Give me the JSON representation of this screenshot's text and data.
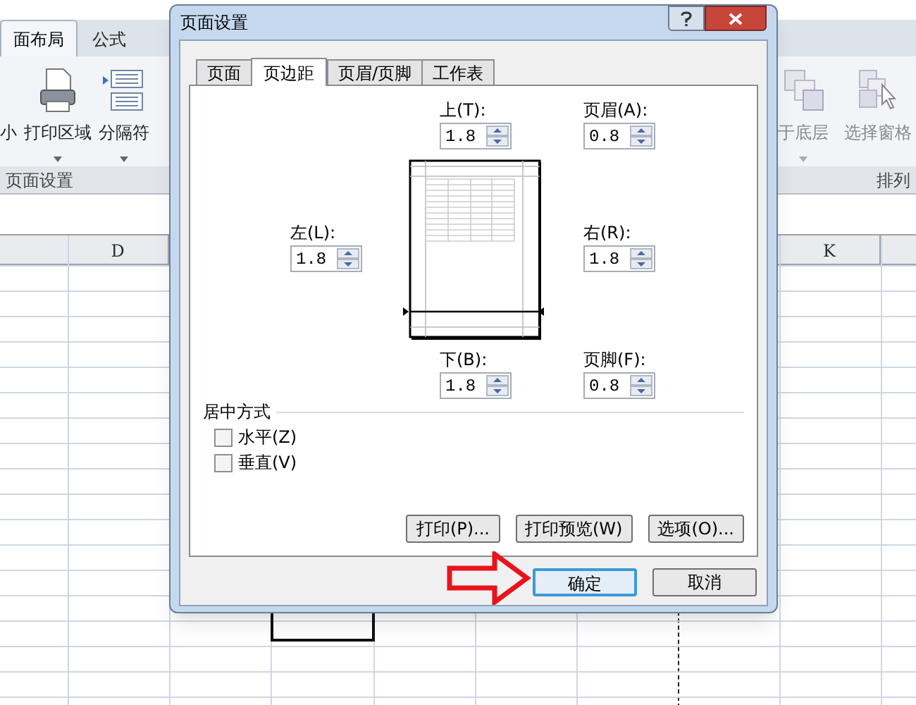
{
  "ribbon": {
    "tabs": [
      {
        "label": "面布局",
        "selected": true
      },
      {
        "label": "公式",
        "selected": false
      }
    ],
    "buttons_left": [
      {
        "label": "小",
        "dropdown": false
      },
      {
        "label": "打印区域",
        "dropdown": true
      },
      {
        "label": "分隔符",
        "dropdown": true
      }
    ],
    "buttons_right": [
      {
        "label": "于底层",
        "dropdown": true
      },
      {
        "label": "选择窗格",
        "dropdown": false
      }
    ],
    "groups": [
      "页面设置",
      "排列"
    ]
  },
  "sheet": {
    "column_headers": [
      "D",
      "K"
    ]
  },
  "dialog": {
    "title": "页面设置",
    "tabs": [
      {
        "label": "页面",
        "selected": false
      },
      {
        "label": "页边距",
        "selected": true
      },
      {
        "label": "页眉/页脚",
        "selected": false
      },
      {
        "label": "工作表",
        "selected": false
      }
    ],
    "margins": [
      {
        "label": "上(T):",
        "value": "1.8"
      },
      {
        "label": "页眉(A):",
        "value": "0.8"
      },
      {
        "label": "左(L):",
        "value": "1.8"
      },
      {
        "label": "右(R):",
        "value": "1.8"
      },
      {
        "label": "下(B):",
        "value": "1.8"
      },
      {
        "label": "页脚(F):",
        "value": "0.8"
      }
    ],
    "centering": {
      "title": "居中方式",
      "options": [
        {
          "label": "水平(Z)",
          "checked": false
        },
        {
          "label": "垂直(V)",
          "checked": false
        }
      ]
    },
    "panel_buttons": [
      "打印(P)...",
      "打印预览(W)",
      "选项(O)..."
    ],
    "buttons": [
      {
        "label": "确定",
        "default": true
      },
      {
        "label": "取消",
        "default": false
      }
    ]
  }
}
